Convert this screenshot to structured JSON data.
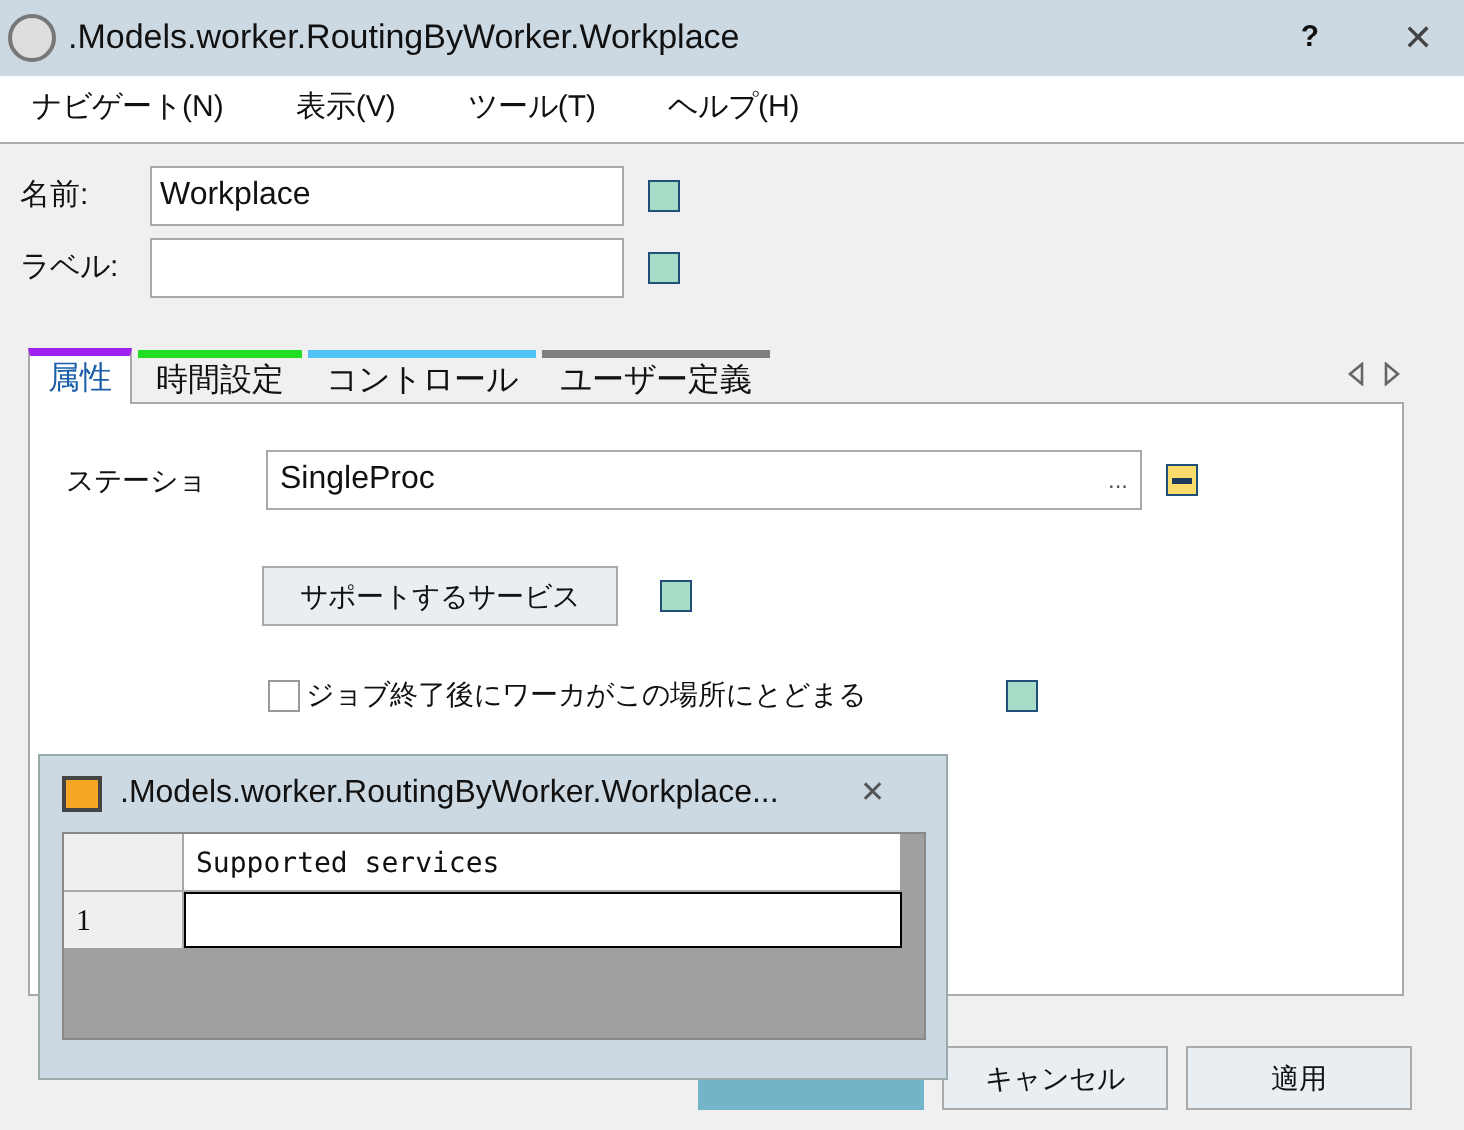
{
  "window": {
    "title": ".Models.worker.RoutingByWorker.Workplace",
    "help": "?",
    "close": "✕"
  },
  "menu": [
    "ナビゲート(N)",
    "表示(V)",
    "ツール(T)",
    "ヘルプ(H)"
  ],
  "fields": [
    {
      "label": "名前:",
      "value": "Workplace",
      "inherited": false
    },
    {
      "label": "ラベル:",
      "inherited": false
    }
  ],
  "tabs": [
    {
      "label": "属性",
      "color": "#a020f0",
      "selected": true
    },
    {
      "label": "時間設定",
      "color": "#22dd22",
      "selected": false
    },
    {
      "label": "コントロール",
      "color": "#4fc3f7",
      "selected": false
    },
    {
      "label": "ユーザー定義",
      "color": "#808080",
      "selected": false
    }
  ],
  "panel": {
    "station": {
      "label": "ステーショ",
      "value": "SingleProc",
      "browse": "...",
      "inherited": true
    },
    "services_button": {
      "label": "サポートするサービス",
      "inherited": false
    },
    "stay_checkbox": {
      "label": "ジョブ終了後にワーカがこの場所にとどまる",
      "checked": false,
      "inherited": false
    }
  },
  "popup": {
    "title": ".Models.worker.RoutingByWorker.Workplace...",
    "close": "✕",
    "columns": [
      "Supported services"
    ],
    "rows": [
      {
        "index": "1"
      }
    ]
  },
  "buttons": [
    {
      "kind": "primary"
    },
    {
      "label": "キャンセル",
      "kind": "normal"
    },
    {
      "label": "適用",
      "kind": "normal"
    }
  ]
}
